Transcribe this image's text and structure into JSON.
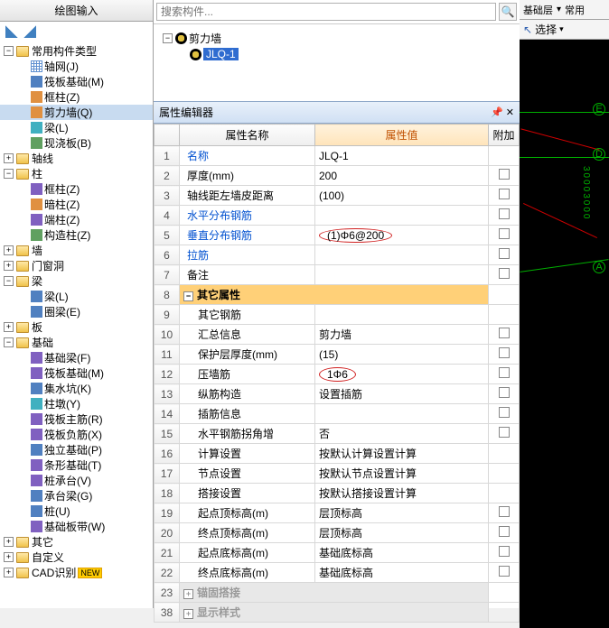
{
  "left": {
    "title": "绘图输入",
    "root": "常用构件类型",
    "root_children": [
      {
        "label": "轴网(J)"
      },
      {
        "label": "筏板基础(M)"
      },
      {
        "label": "框柱(Z)"
      },
      {
        "label": "剪力墙(Q)",
        "selected": true
      },
      {
        "label": "梁(L)"
      },
      {
        "label": "现浇板(B)"
      }
    ],
    "nodes": [
      {
        "label": "轴线",
        "expand": "+",
        "depth": 0
      },
      {
        "label": "柱",
        "expand": "-",
        "depth": 0
      },
      {
        "label": "框柱(Z)",
        "depth": 1
      },
      {
        "label": "暗柱(Z)",
        "depth": 1
      },
      {
        "label": "端柱(Z)",
        "depth": 1
      },
      {
        "label": "构造柱(Z)",
        "depth": 1
      },
      {
        "label": "墙",
        "expand": "+",
        "depth": 0
      },
      {
        "label": "门窗洞",
        "expand": "+",
        "depth": 0
      },
      {
        "label": "梁",
        "expand": "-",
        "depth": 0
      },
      {
        "label": "梁(L)",
        "depth": 1
      },
      {
        "label": "圈梁(E)",
        "depth": 1
      },
      {
        "label": "板",
        "expand": "+",
        "depth": 0
      },
      {
        "label": "基础",
        "expand": "-",
        "depth": 0
      },
      {
        "label": "基础梁(F)",
        "depth": 1
      },
      {
        "label": "筏板基础(M)",
        "depth": 1
      },
      {
        "label": "集水坑(K)",
        "depth": 1
      },
      {
        "label": "柱墩(Y)",
        "depth": 1
      },
      {
        "label": "筏板主筋(R)",
        "depth": 1
      },
      {
        "label": "筏板负筋(X)",
        "depth": 1
      },
      {
        "label": "独立基础(P)",
        "depth": 1
      },
      {
        "label": "条形基础(T)",
        "depth": 1
      },
      {
        "label": "桩承台(V)",
        "depth": 1
      },
      {
        "label": "承台梁(G)",
        "depth": 1
      },
      {
        "label": "桩(U)",
        "depth": 1
      },
      {
        "label": "基础板带(W)",
        "depth": 1
      },
      {
        "label": "其它",
        "expand": "+",
        "depth": 0
      },
      {
        "label": "自定义",
        "expand": "+",
        "depth": 0
      },
      {
        "label": "CAD识别",
        "expand": "+",
        "depth": 0,
        "new": true
      }
    ]
  },
  "mid": {
    "search_placeholder": "搜索构件...",
    "mini_tree": {
      "root": "剪力墙",
      "child": "JLQ-1"
    },
    "prop_title": "属性编辑器",
    "headers": {
      "name": "属性名称",
      "value": "属性值",
      "extra": "附加"
    },
    "rows": [
      {
        "n": "1",
        "name": "名称",
        "val": "JLQ-1",
        "link": true
      },
      {
        "n": "2",
        "name": "厚度(mm)",
        "val": "200",
        "chk": true
      },
      {
        "n": "3",
        "name": "轴线距左墙皮距离",
        "val": "(100)",
        "chk": true
      },
      {
        "n": "4",
        "name": "水平分布钢筋",
        "val": "",
        "link": true,
        "chk": true
      },
      {
        "n": "5",
        "name": "垂直分布钢筋",
        "val": "(1)Φ6@200",
        "link": true,
        "chk": true,
        "circle": true
      },
      {
        "n": "6",
        "name": "拉筋",
        "val": "",
        "link": true,
        "chk": true
      },
      {
        "n": "7",
        "name": "备注",
        "val": "",
        "chk": true
      },
      {
        "n": "8",
        "name": "其它属性",
        "group": true,
        "sel": true,
        "expand": "-"
      },
      {
        "n": "9",
        "name": "其它钢筋",
        "val": ""
      },
      {
        "n": "10",
        "name": "汇总信息",
        "val": "剪力墙",
        "chk": true
      },
      {
        "n": "11",
        "name": "保护层厚度(mm)",
        "val": "(15)",
        "chk": true
      },
      {
        "n": "12",
        "name": "压墙筋",
        "val": "1Φ6",
        "chk": true,
        "circle": true
      },
      {
        "n": "13",
        "name": "纵筋构造",
        "val": "设置插筋",
        "chk": true
      },
      {
        "n": "14",
        "name": "插筋信息",
        "val": "",
        "chk": true
      },
      {
        "n": "15",
        "name": "水平钢筋拐角增",
        "val": "否",
        "chk": true
      },
      {
        "n": "16",
        "name": "计算设置",
        "val": "按默认计算设置计算"
      },
      {
        "n": "17",
        "name": "节点设置",
        "val": "按默认节点设置计算"
      },
      {
        "n": "18",
        "name": "搭接设置",
        "val": "按默认搭接设置计算"
      },
      {
        "n": "19",
        "name": "起点顶标高(m)",
        "val": "层顶标高",
        "chk": true
      },
      {
        "n": "20",
        "name": "终点顶标高(m)",
        "val": "层顶标高",
        "chk": true
      },
      {
        "n": "21",
        "name": "起点底标高(m)",
        "val": "基础底标高",
        "chk": true
      },
      {
        "n": "22",
        "name": "终点底标高(m)",
        "val": "基础底标高",
        "chk": true
      },
      {
        "n": "23",
        "name": "锚固搭接",
        "group": true,
        "expand": "+",
        "disabled": true
      },
      {
        "n": "38",
        "name": "显示样式",
        "group": true,
        "expand": "+",
        "disabled": true
      }
    ]
  },
  "right": {
    "layer_label": "基础层",
    "mode": "常用",
    "select_label": "选择",
    "axis_labels": [
      "E",
      "D",
      "A"
    ],
    "dim": "30003000"
  }
}
